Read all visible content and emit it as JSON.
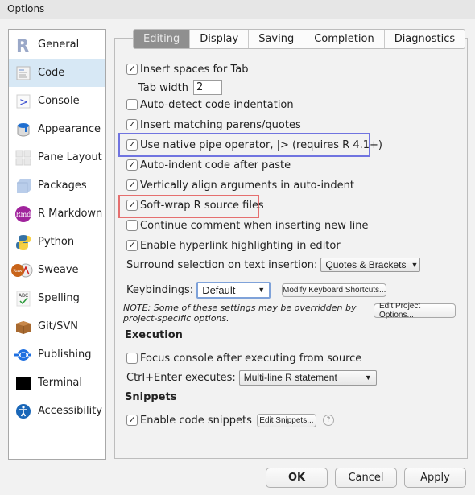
{
  "window": {
    "title": "Options"
  },
  "sidebar": {
    "items": [
      {
        "label": "General",
        "icon": "r-logo-icon"
      },
      {
        "label": "Code",
        "icon": "code-document-icon",
        "selected": true
      },
      {
        "label": "Console",
        "icon": "console-prompt-icon"
      },
      {
        "label": "Appearance",
        "icon": "paint-bucket-icon"
      },
      {
        "label": "Pane Layout",
        "icon": "pane-grid-icon"
      },
      {
        "label": "Packages",
        "icon": "package-cube-icon"
      },
      {
        "label": "R Markdown",
        "icon": "rmd-icon"
      },
      {
        "label": "Python",
        "icon": "python-icon"
      },
      {
        "label": "Sweave",
        "icon": "sweave-pdf-icon"
      },
      {
        "label": "Spelling",
        "icon": "spelling-abc-icon"
      },
      {
        "label": "Git/SVN",
        "icon": "git-box-icon"
      },
      {
        "label": "Publishing",
        "icon": "publishing-icon"
      },
      {
        "label": "Terminal",
        "icon": "terminal-icon"
      },
      {
        "label": "Accessibility",
        "icon": "accessibility-icon"
      }
    ]
  },
  "tabs": [
    {
      "label": "Editing",
      "active": true
    },
    {
      "label": "Display"
    },
    {
      "label": "Saving"
    },
    {
      "label": "Completion"
    },
    {
      "label": "Diagnostics"
    }
  ],
  "editing": {
    "insert_spaces": {
      "label": "Insert spaces for Tab",
      "checked": true
    },
    "tab_width": {
      "label": "Tab width",
      "value": "2"
    },
    "auto_detect": {
      "label": "Auto-detect code indentation",
      "checked": false
    },
    "matching_parens": {
      "label": "Insert matching parens/quotes",
      "checked": true
    },
    "native_pipe": {
      "label": "Use native pipe operator, |> (requires R 4.1+)",
      "checked": true
    },
    "auto_indent_paste": {
      "label": "Auto-indent code after paste",
      "checked": true
    },
    "vertical_align": {
      "label": "Vertically align arguments in auto-indent",
      "checked": true
    },
    "soft_wrap": {
      "label": "Soft-wrap R source files",
      "checked": true
    },
    "continue_comment": {
      "label": "Continue comment when inserting new line",
      "checked": false
    },
    "hyperlink": {
      "label": "Enable hyperlink highlighting in editor",
      "checked": true
    },
    "surround": {
      "label": "Surround selection on text insertion:",
      "value": "Quotes & Brackets"
    },
    "keybindings": {
      "label": "Keybindings:",
      "value": "Default",
      "modify_button": "Modify Keyboard Shortcuts..."
    },
    "note": "NOTE: Some of these settings may be overridden by project-specific options.",
    "edit_project_button": "Edit Project Options..."
  },
  "execution": {
    "heading": "Execution",
    "focus_console": {
      "label": "Focus console after executing from source",
      "checked": false
    },
    "ctrl_enter": {
      "label": "Ctrl+Enter executes:",
      "value": "Multi-line R statement"
    }
  },
  "snippets": {
    "heading": "Snippets",
    "enable": {
      "label": "Enable code snippets",
      "checked": true
    },
    "edit_button": "Edit Snippets...",
    "help": "?"
  },
  "buttons": {
    "ok": "OK",
    "cancel": "Cancel",
    "apply": "Apply"
  },
  "check_glyph": "✓",
  "arrow_glyph": "▼"
}
